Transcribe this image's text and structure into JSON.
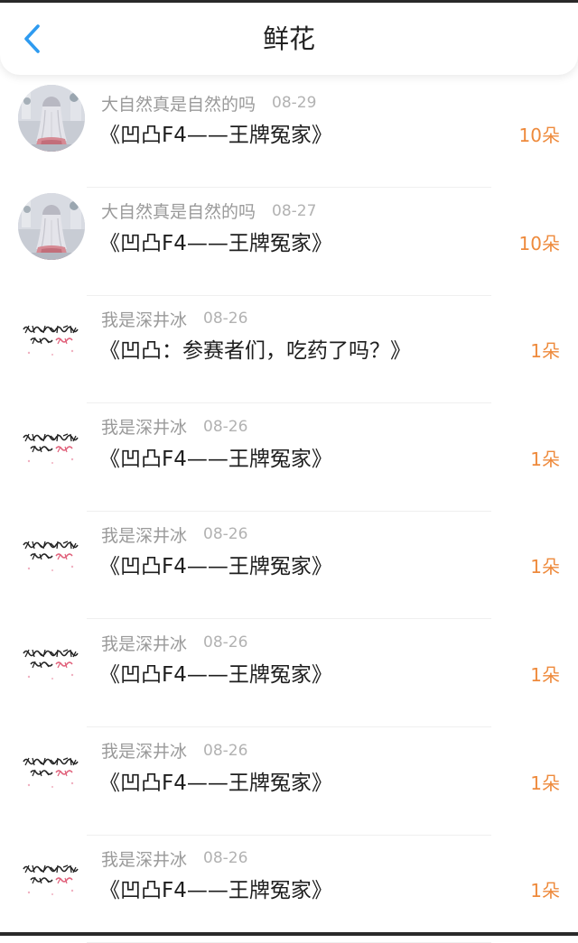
{
  "header": {
    "title": "鲜花",
    "back_icon": "chevron-left-icon",
    "accent_color": "#2e9bf0"
  },
  "flowers": [
    {
      "user": "大自然真是自然的吗",
      "date": "08-29",
      "title": "《凹凸F4——王牌冤家》",
      "count": "10朵",
      "avatar": "girl-silhouette"
    },
    {
      "user": "大自然真是自然的吗",
      "date": "08-27",
      "title": "《凹凸F4——王牌冤家》",
      "count": "10朵",
      "avatar": "girl-silhouette"
    },
    {
      "user": "我是深井冰",
      "date": "08-26",
      "title": "《凹凸：参赛者们，吃药了吗？》",
      "count": "1朵",
      "avatar": "handwritten-text"
    },
    {
      "user": "我是深井冰",
      "date": "08-26",
      "title": "《凹凸F4——王牌冤家》",
      "count": "1朵",
      "avatar": "handwritten-text"
    },
    {
      "user": "我是深井冰",
      "date": "08-26",
      "title": "《凹凸F4——王牌冤家》",
      "count": "1朵",
      "avatar": "handwritten-text"
    },
    {
      "user": "我是深井冰",
      "date": "08-26",
      "title": "《凹凸F4——王牌冤家》",
      "count": "1朵",
      "avatar": "handwritten-text"
    },
    {
      "user": "我是深井冰",
      "date": "08-26",
      "title": "《凹凸F4——王牌冤家》",
      "count": "1朵",
      "avatar": "handwritten-text"
    },
    {
      "user": "我是深井冰",
      "date": "08-26",
      "title": "《凹凸F4——王牌冤家》",
      "count": "1朵",
      "avatar": "handwritten-text"
    }
  ],
  "colors": {
    "count": "#ee8a3c",
    "username": "#9a9a9a",
    "title": "#1e1e1e"
  }
}
